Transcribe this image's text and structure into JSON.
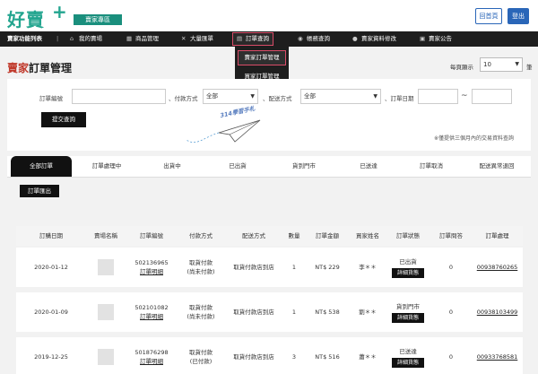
{
  "header": {
    "logo": "好賣",
    "logo_plus": "+",
    "zone_badge": "賣家專區",
    "home_label": "回首頁",
    "logout_label": "登出"
  },
  "nav": {
    "title": "賣家功能列表",
    "title_sep": "|",
    "items": [
      {
        "label": "我的賣場",
        "icon": "home-icon"
      },
      {
        "label": "商品管理",
        "icon": "grid-icon"
      },
      {
        "label": "大量匯單",
        "icon": "tools-icon"
      },
      {
        "label": "訂單查詢",
        "icon": "cart-icon"
      },
      {
        "label": "帳務查詢",
        "icon": "coin-icon"
      },
      {
        "label": "賣家資料修改",
        "icon": "user-icon"
      },
      {
        "label": "賣家公告",
        "icon": "doc-icon"
      }
    ]
  },
  "dropdown": {
    "items": [
      "賣家訂單管理",
      "買家訂單管理"
    ]
  },
  "page": {
    "title_hl": "賣家",
    "title_rest": "訂單管理",
    "perpage_label": "每頁顯示",
    "perpage_value": "10",
    "perpage_unit": "筆"
  },
  "search": {
    "order_no_label": "訂單編號",
    "payment_label": "、付款方式",
    "payment_value": "全部",
    "shipping_label": "、配送方式",
    "shipping_value": "全部",
    "date_label": "、訂單日期",
    "date_sep": "~",
    "submit_label": "提交查詢",
    "note": "※僅提供三個月內的交易資料查詢",
    "deco_text": "314學習手札"
  },
  "tabs": [
    "全部訂單",
    "訂單處理中",
    "出貨中",
    "已出貨",
    "貨到門市",
    "已送達",
    "訂單取消",
    "配送異常退回"
  ],
  "export_label": "訂單匯出",
  "table": {
    "columns": [
      "訂購日期",
      "賣場名稱",
      "訂單編號",
      "付款方式",
      "配送方式",
      "數量",
      "訂單金額",
      "買家姓名",
      "訂單狀態",
      "訂單問答",
      "訂單處理"
    ],
    "detail_link": "訂單明細",
    "detail_btn": "詳細貨態",
    "rows": [
      {
        "date": "2020-01-12",
        "order_no": "502136965",
        "pay1": "取貨付款",
        "pay2": "(尚未付款)",
        "ship": "取貨付款店到店",
        "qty": "1",
        "amount": "NT$ 229",
        "buyer": "李＊＊",
        "status": "已出貨",
        "qa": "0",
        "ship_no": "00938760265"
      },
      {
        "date": "2020-01-09",
        "order_no": "502101082",
        "pay1": "取貨付款",
        "pay2": "(尚未付款)",
        "ship": "取貨付款店到店",
        "qty": "1",
        "amount": "NT$ 538",
        "buyer": "劉＊＊",
        "status": "貨到門市",
        "qa": "0",
        "ship_no": "00938103499"
      },
      {
        "date": "2019-12-25",
        "order_no": "501876298",
        "pay1": "取貨付款",
        "pay2": "(已付款)",
        "ship": "取貨付款店到店",
        "qty": "3",
        "amount": "NT$ 516",
        "buyer": "蕭＊＊",
        "status": "已送達",
        "qa": "0",
        "ship_no": "00933768581"
      }
    ]
  }
}
